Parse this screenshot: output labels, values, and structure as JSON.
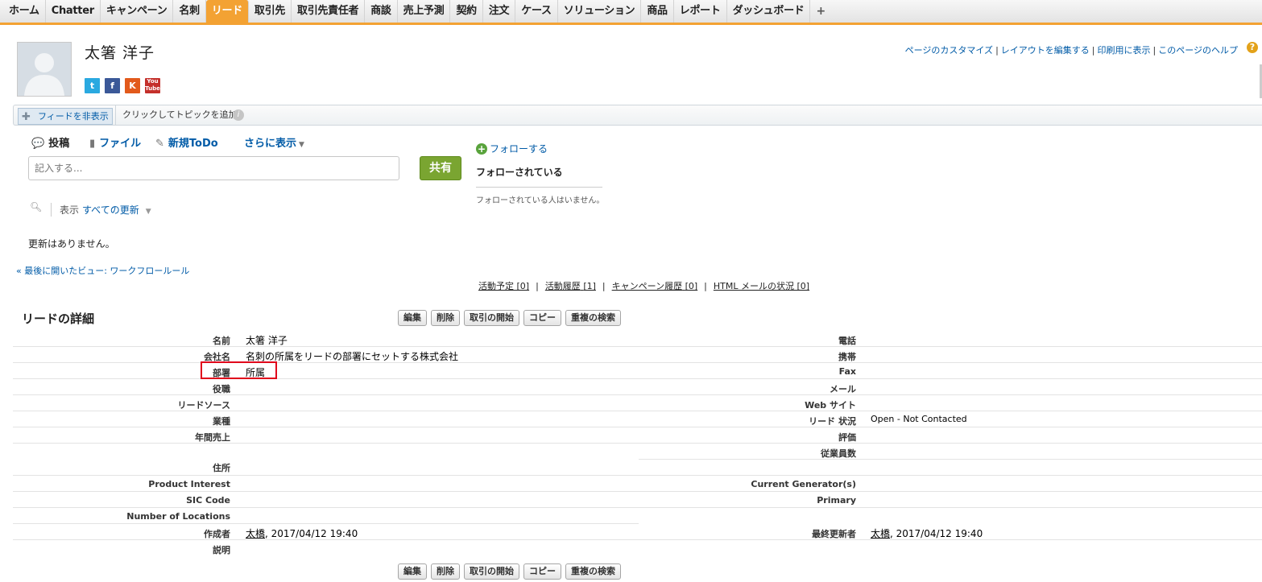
{
  "tabs": [
    {
      "label": "ホーム",
      "active": false
    },
    {
      "label": "Chatter",
      "active": false
    },
    {
      "label": "キャンペーン",
      "active": false
    },
    {
      "label": "名刺",
      "active": false
    },
    {
      "label": "リード",
      "active": true
    },
    {
      "label": "取引先",
      "active": false
    },
    {
      "label": "取引先責任者",
      "active": false
    },
    {
      "label": "商談",
      "active": false
    },
    {
      "label": "売上予測",
      "active": false
    },
    {
      "label": "契約",
      "active": false
    },
    {
      "label": "注文",
      "active": false
    },
    {
      "label": "ケース",
      "active": false
    },
    {
      "label": "ソリューション",
      "active": false
    },
    {
      "label": "商品",
      "active": false
    },
    {
      "label": "レポート",
      "active": false
    },
    {
      "label": "ダッシュボード",
      "active": false
    }
  ],
  "tab_add": "+",
  "record": {
    "name": "太箸 洋子"
  },
  "social": {
    "twitter": "t",
    "facebook": "f",
    "klout": "K",
    "youtube": "You Tube"
  },
  "header_links": {
    "customize": "ページのカスタマイズ",
    "edit_layout": "レイアウトを編集する",
    "print": "印刷用に表示",
    "help": "このページのヘルプ",
    "help_icon": "?"
  },
  "chatter": {
    "hide_feed": "フィードを非表示",
    "add_topic": "クリックしてトピックを追加:",
    "info": "i"
  },
  "publisher": {
    "post": "投稿",
    "file": "ファイル",
    "new_todo": "新規ToDo",
    "more": "さらに表示",
    "input_placeholder": "記入する...",
    "share": "共有"
  },
  "follow": {
    "follow_label": "フォローする",
    "followers_title": "フォローされている",
    "no_followers": "フォローされている人はいません。"
  },
  "feed_filter": {
    "show_label": "表示",
    "value": "すべての更新"
  },
  "no_updates": "更新はありません。",
  "last_view": "« 最後に開いたビュー: ワークフロールール",
  "related": [
    {
      "label": "活動予定",
      "count": "[0]"
    },
    {
      "label": "活動履歴",
      "count": "[1]"
    },
    {
      "label": "キャンペーン履歴",
      "count": "[0]"
    },
    {
      "label": "HTML メールの状況",
      "count": "[0]"
    }
  ],
  "detail": {
    "title": "リードの詳細",
    "buttons": {
      "edit": "編集",
      "delete": "削除",
      "convert": "取引の開始",
      "copy": "コピー",
      "find_dup": "重複の検索"
    },
    "left": [
      {
        "label": "名前",
        "value": "太箸 洋子"
      },
      {
        "label": "会社名",
        "value": "名刺の所属をリードの部署にセットする株式会社"
      },
      {
        "label": "部署",
        "value": "所属"
      },
      {
        "label": "役職",
        "value": ""
      },
      {
        "label": "リードソース",
        "value": ""
      },
      {
        "label": "業種",
        "value": ""
      },
      {
        "label": "年間売上",
        "value": ""
      }
    ],
    "right": [
      {
        "label": "電話",
        "value": ""
      },
      {
        "label": "携帯",
        "value": ""
      },
      {
        "label": "Fax",
        "value": ""
      },
      {
        "label": "メール",
        "value": ""
      },
      {
        "label": "Web サイト",
        "value": ""
      },
      {
        "label": "リード 状況",
        "value": "Open - Not Contacted"
      },
      {
        "label": "評価",
        "value": ""
      },
      {
        "label": "従業員数",
        "value": ""
      }
    ],
    "address": {
      "label": "住所",
      "value": ""
    },
    "product_interest": {
      "label": "Product Interest",
      "value": ""
    },
    "current_generator": {
      "label": "Current Generator(s)",
      "value": ""
    },
    "sic_code": {
      "label": "SIC Code",
      "value": ""
    },
    "primary": {
      "label": "Primary",
      "value": ""
    },
    "num_locations": {
      "label": "Number of Locations",
      "value": ""
    },
    "created_by": {
      "label": "作成者",
      "user": "太橋",
      "date": ", 2017/04/12 19:40"
    },
    "modified_by": {
      "label": "最終更新者",
      "user": "太橋",
      "date": ", 2017/04/12 19:40"
    },
    "description": {
      "label": "説明",
      "value": ""
    }
  },
  "colors": {
    "accent": "#f3a233",
    "link": "#015ba7",
    "share": "#7aa531",
    "highlight": "#e0001b"
  }
}
